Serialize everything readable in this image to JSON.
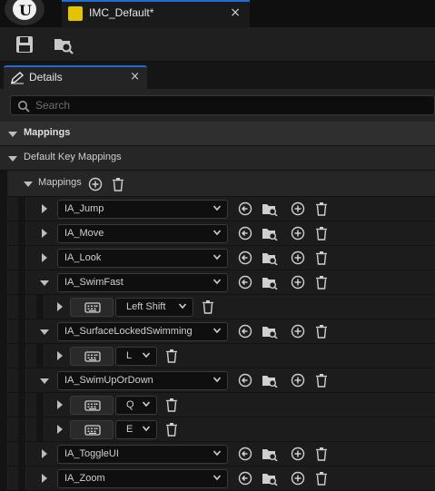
{
  "document_tab": {
    "title": "IMC_Default*",
    "close": "×"
  },
  "panel": {
    "title": "Details",
    "close": "×"
  },
  "search": {
    "placeholder": "Search"
  },
  "sections": {
    "mappings": "Mappings",
    "default_key_mappings": "Default Key Mappings",
    "mappings_array": "Mappings"
  },
  "mappings": [
    {
      "action": "IA_Jump",
      "expanded": false,
      "keys": []
    },
    {
      "action": "IA_Move",
      "expanded": false,
      "keys": []
    },
    {
      "action": "IA_Look",
      "expanded": false,
      "keys": []
    },
    {
      "action": "IA_SwimFast",
      "expanded": true,
      "keys": [
        "Left Shift"
      ]
    },
    {
      "action": "IA_SurfaceLockedSwimming",
      "expanded": true,
      "keys": [
        "L"
      ]
    },
    {
      "action": "IA_SwimUpOrDown",
      "expanded": true,
      "keys": [
        "Q",
        "E"
      ]
    },
    {
      "action": "IA_ToggleUI",
      "expanded": false,
      "keys": []
    },
    {
      "action": "IA_Zoom",
      "expanded": false,
      "keys": []
    }
  ],
  "icons": {
    "logo": "unreal-logo-icon",
    "save": "save-icon",
    "browse": "browse-to-asset-icon",
    "details": "details-pencil-icon",
    "search": "search-icon",
    "add": "add-element-icon",
    "delete": "trash-icon",
    "reset": "reset-to-default-icon",
    "keyboard": "keyboard-icon"
  },
  "colors": {
    "accent": "#1f6fd1",
    "asset_tab_icon": "#e2c400"
  }
}
